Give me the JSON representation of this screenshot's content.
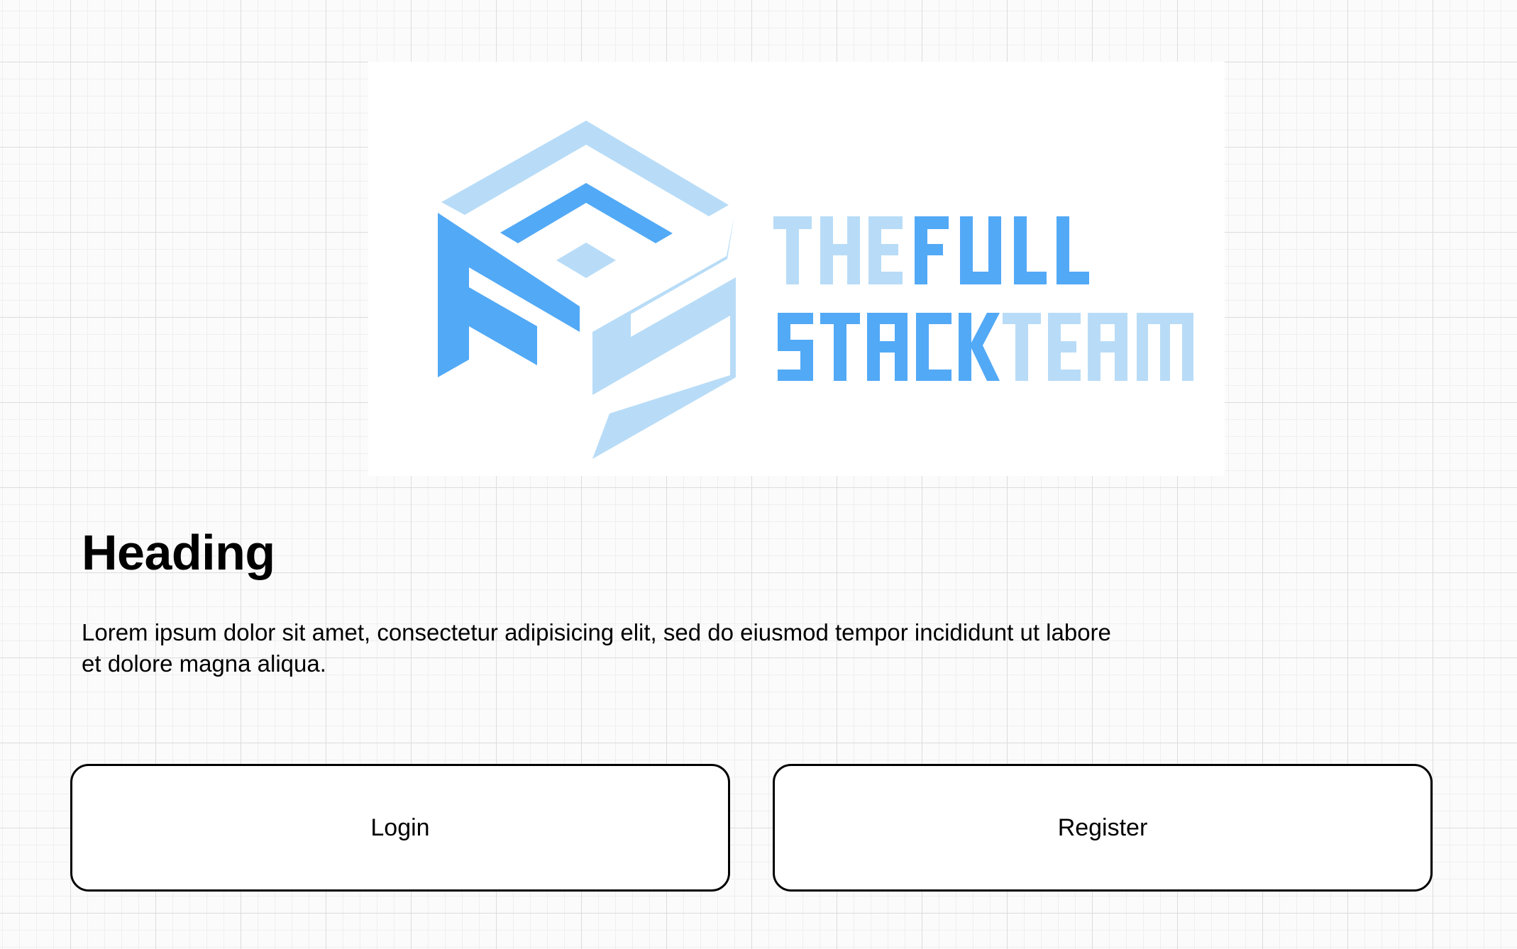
{
  "hero": {
    "logo_icon": "fs-cube-logo-icon",
    "brand_text": "THEFULL STACKTEAM",
    "colors": {
      "light_blue": "#b8dcf7",
      "blue": "#52a9f6"
    }
  },
  "content": {
    "heading": "Heading",
    "body": "Lorem ipsum dolor sit amet, consectetur adipisicing elit, sed do eiusmod tempor incididunt ut labore et dolore magna aliqua."
  },
  "actions": {
    "login_label": "Login",
    "register_label": "Register"
  }
}
